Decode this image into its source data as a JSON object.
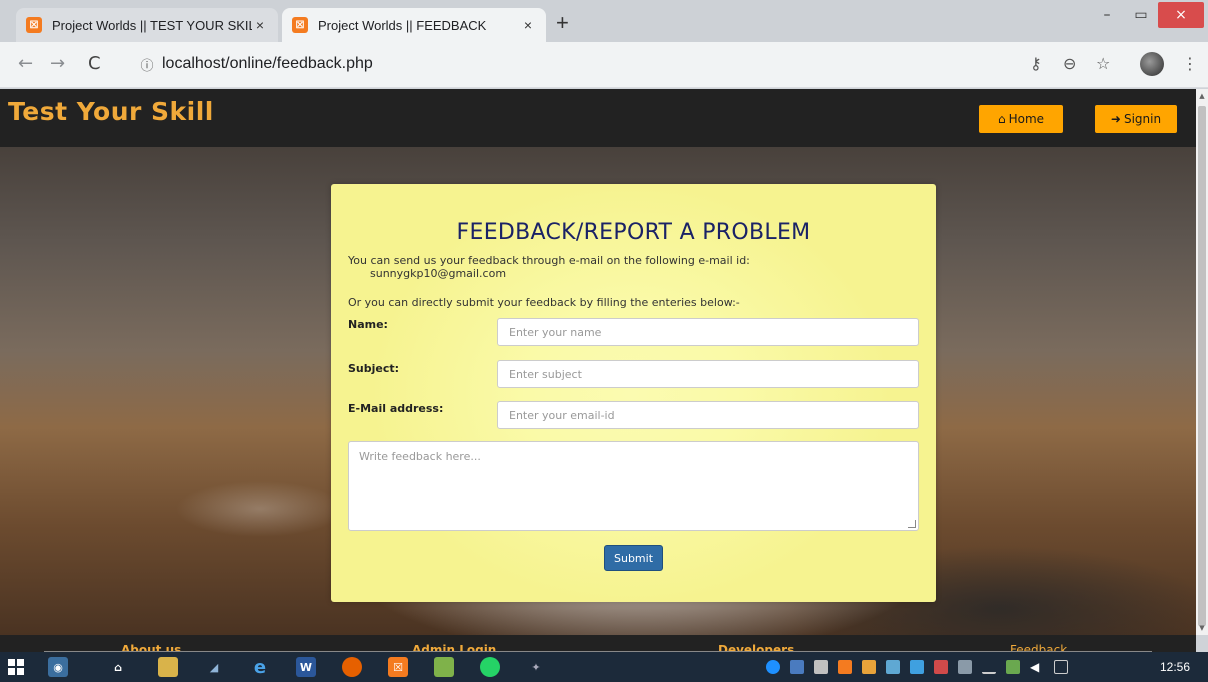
{
  "browser": {
    "tabs": [
      {
        "title": "Project Worlds || TEST YOUR SKIL",
        "favicon": "xampp-icon",
        "active": false
      },
      {
        "title": "Project Worlds || FEEDBACK",
        "favicon": "xampp-icon",
        "active": true
      }
    ],
    "new_tab_glyph": "+",
    "close_glyph": "×",
    "url": "localhost/online/feedback.php",
    "nav": {
      "back": "←",
      "forward": "→",
      "reload": "C"
    },
    "toolbar_icons": [
      "key-icon",
      "zoom-icon",
      "star-icon",
      "profile-avatar",
      "menu-icon"
    ],
    "win_controls": {
      "minimize": "–",
      "maximize": "▭",
      "close": "×"
    }
  },
  "site": {
    "brand": "Test Your Skill",
    "nav": {
      "home_label": "Home",
      "signin_label": "Signin",
      "accent": "#ffa500"
    },
    "feedback": {
      "title": "FEEDBACK/REPORT A PROBLEM",
      "intro": "You can send us your feedback through e-mail on the following e-mail id:",
      "email": "sunnygkp10@gmail.com",
      "alt_text": "Or you can directly submit your feedback by filling the enteries below:-",
      "name_label": "Name:",
      "name_placeholder": "Enter your name",
      "subject_label": "Subject:",
      "subject_placeholder": "Enter subject",
      "email_label": "E-Mail address:",
      "email_placeholder": "Enter your email-id",
      "feedback_placeholder": "Write feedback here...",
      "submit_label": "Submit"
    },
    "footer": {
      "links": [
        "About us",
        "Admin Login",
        "Developers",
        "Feedback"
      ]
    }
  },
  "taskbar": {
    "clock": "12:56"
  }
}
